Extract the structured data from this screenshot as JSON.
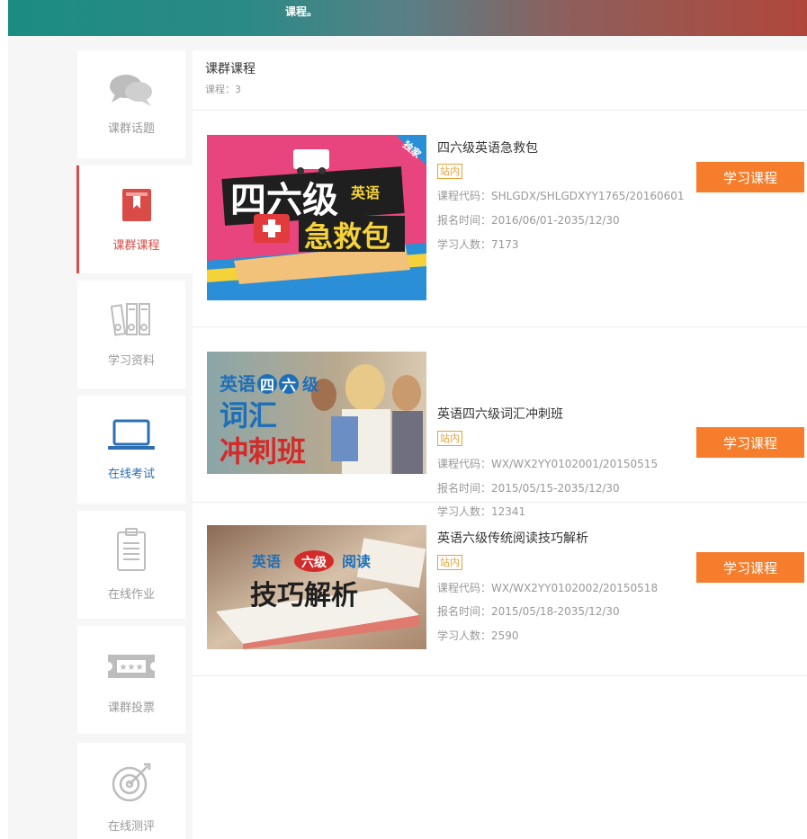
{
  "banner": {
    "text": "课程。"
  },
  "sidebar": {
    "items": [
      {
        "label": "课群话题"
      },
      {
        "label": "课群课程"
      },
      {
        "label": "学习资料"
      },
      {
        "label": "在线考试"
      },
      {
        "label": "在线作业"
      },
      {
        "label": "课群投票"
      },
      {
        "label": "在线测评"
      }
    ]
  },
  "header": {
    "title": "课群课程",
    "count": "课程：3"
  },
  "courses": [
    {
      "name": "四六级英语急救包",
      "tag": "站内",
      "code": "课程代码：SHLGDX/SHLGDXYY1765/20160601",
      "period": "报名时间：2016/06/01-2035/12/30",
      "learners": "学习人数：7173",
      "button": "学习课程",
      "thumb": {
        "corner": "独家",
        "line1": "四六级",
        "line1b": "英语",
        "line2": "急救包"
      }
    },
    {
      "name": "英语四六级词汇冲刺班",
      "tag": "站内",
      "code": "课程代码：WX/WX2YY0102001/20150515",
      "period": "报名时间：2015/05/15-2035/12/30",
      "learners": "学习人数：12341",
      "button": "学习课程",
      "thumb": {
        "top": "英语",
        "c1": "四",
        "c2": "六",
        "top2": "级",
        "mid": "词汇",
        "bottom": "冲刺班"
      }
    },
    {
      "name": "英语六级传统阅读技巧解析",
      "tag": "站内",
      "code": "课程代码：WX/WX2YY0102002/20150518",
      "period": "报名时间：2015/05/18-2035/12/30",
      "learners": "学习人数：2590",
      "button": "学习课程",
      "thumb": {
        "a": "英语",
        "b": "六级",
        "c": "阅读",
        "big": "技巧解析"
      }
    }
  ],
  "colors": {
    "accent": "#f57d2b",
    "active": "#d94b47",
    "blue": "#2d6fb3",
    "tag": "#e8a13a"
  }
}
